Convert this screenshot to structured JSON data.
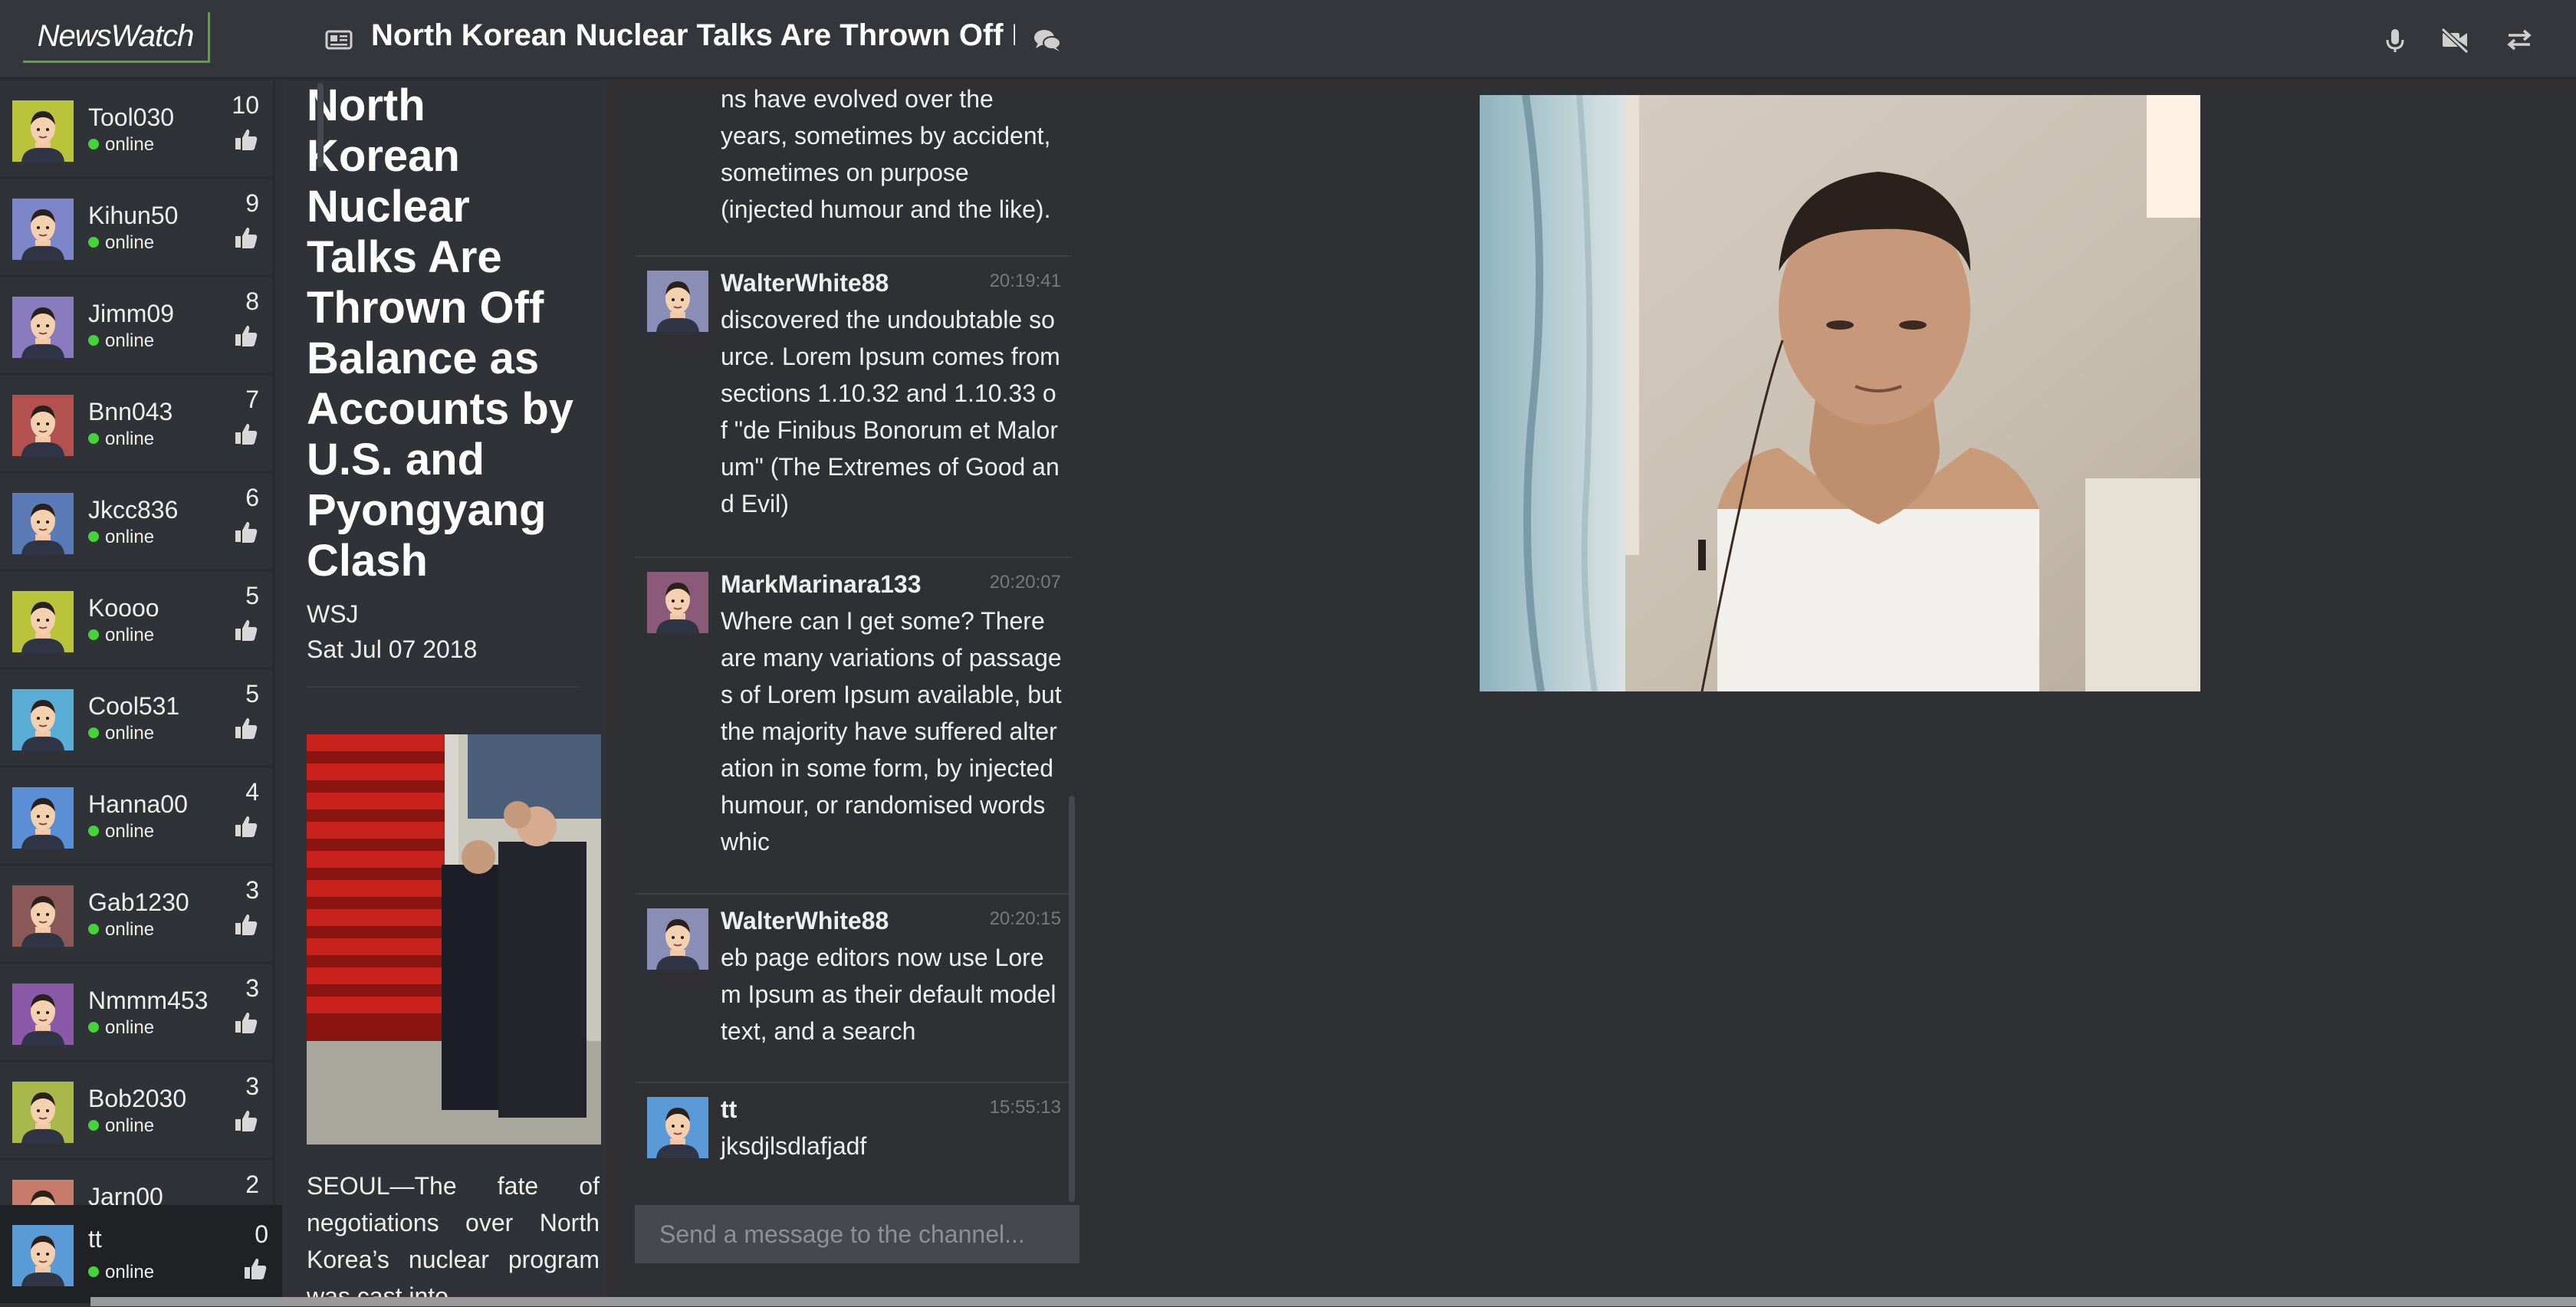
{
  "app": {
    "logo_text_news": "News",
    "logo_text_watch": "Watch",
    "article_icon": "newspaper-icon",
    "header_title": "North Korean Nuclear Talks Are Thrown Off Balance as Accounts by U.S. and Pyongyang Clash",
    "chat_icon": "chat-bubbles-icon",
    "controls": [
      "microphone-icon",
      "video-off-icon",
      "swap-icon"
    ]
  },
  "users": [
    {
      "name": "Tool030",
      "status": "online",
      "likes": "10",
      "avatar_color": "#b9c43a"
    },
    {
      "name": "Kihun50",
      "status": "online",
      "likes": "9",
      "avatar_color": "#7c86c8"
    },
    {
      "name": "Jimm09",
      "status": "online",
      "likes": "8",
      "avatar_color": "#8a7bbf"
    },
    {
      "name": "Bnn043",
      "status": "online",
      "likes": "7",
      "avatar_color": "#b35050"
    },
    {
      "name": "Jkcc836",
      "status": "online",
      "likes": "6",
      "avatar_color": "#5a7bb5"
    },
    {
      "name": "Koooo",
      "status": "online",
      "likes": "5",
      "avatar_color": "#b9c43a"
    },
    {
      "name": "Cool531",
      "status": "online",
      "likes": "5",
      "avatar_color": "#5aaed6"
    },
    {
      "name": "Hanna00",
      "status": "online",
      "likes": "4",
      "avatar_color": "#5a8fd6"
    },
    {
      "name": "Gab1230",
      "status": "online",
      "likes": "3",
      "avatar_color": "#8a5858"
    },
    {
      "name": "Nmmm453",
      "status": "online",
      "likes": "3",
      "avatar_color": "#8a5aa8"
    },
    {
      "name": "Bob2030",
      "status": "online",
      "likes": "3",
      "avatar_color": "#a8b84a"
    },
    {
      "name": "Jarn00",
      "status": "",
      "likes": "2",
      "avatar_color": "#c87b6a"
    }
  ],
  "me": {
    "name": "tt",
    "status": "online",
    "likes": "0",
    "avatar_color": "#5a9ad6"
  },
  "article": {
    "title": "North Korean Nuclear Talks Are Thrown Off Balance as Accounts by U.S. and Pyongyang Clash",
    "source": "WSJ",
    "date": "Sat Jul 07 2018",
    "body": "SEOUL—The fate of negotiations over North Korea’s nuclear program was cast into"
  },
  "chat": {
    "partial_message": "ns have evolved over the years, sometimes by accident, sometimes on purpose (injected humour and the like).",
    "messages": [
      {
        "author": "WalterWhite88",
        "time": "20:19:41",
        "text": "discovered the undoubtable source. Lorem Ipsum comes from sections 1.10.32 and 1.10.33 of \"de Finibus Bonorum et Malorum\" (The Extremes of Good and Evil)",
        "avatar_color": "#8a8db5"
      },
      {
        "author": "MarkMarinara133",
        "time": "20:20:07",
        "text": "Where can I get some? There are many variations of passages of Lorem Ipsum available, but the majority have suffered alteration in some form, by injected humour, or randomised words whic",
        "avatar_color": "#8a5a78"
      },
      {
        "author": "WalterWhite88",
        "time": "20:20:15",
        "text": "eb page editors now use Lorem Ipsum as their default model text, and a search",
        "avatar_color": "#8a8db5"
      },
      {
        "author": "tt",
        "time": "15:55:13",
        "text": "jksdjlsdlafjadf",
        "avatar_color": "#5a9ad6"
      }
    ],
    "input_placeholder": "Send a message to the channel..."
  }
}
